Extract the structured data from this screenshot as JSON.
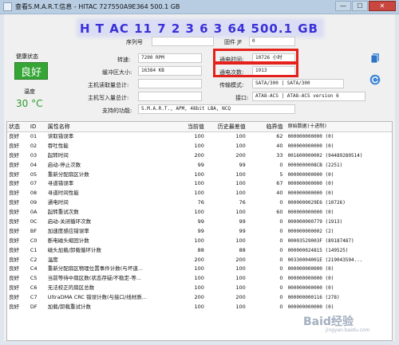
{
  "window": {
    "title": "查看S.M.A.R.T.信息 - HITAC    727550A9E364 500.1 GB",
    "min": "—",
    "max": "☐",
    "close": "✕"
  },
  "header": {
    "model": "H T AC   11 7 2   3   6 3 64 500.1 GB"
  },
  "info": {
    "serial_label": "序列号",
    "serial_value": "",
    "firmware_label": "固件 JF",
    "firmware_value": "0",
    "rpm_label": "转速:",
    "rpm_value": "7200 RPM",
    "buffer_label": "缓冲区大小:",
    "buffer_value": "16384 KB",
    "host_read_label": "主机读取量总计:",
    "host_read_value": "",
    "host_write_label": "主机写入量总计:",
    "host_write_value": "",
    "features_label": "支持的功能:",
    "features_value": "S.M.A.R.T., APM, 48bit LBA, NCQ",
    "power_on_hours_label": "通电时间:",
    "power_on_hours_value": "10726 小时",
    "power_on_count_label": "通电次数:",
    "power_on_count_value": "1913",
    "transfer_label": "传输模式:",
    "transfer_value": "SATA/300 | SATA/300",
    "interface_label": "接口:",
    "interface_value": "ATA8-ACS | ATA8-ACS version 6"
  },
  "status": {
    "health_label": "健康状态",
    "health_value": "良好",
    "temp_label": "温度",
    "temp_value": "30 °C"
  },
  "table": {
    "headers": [
      "状态",
      "ID",
      "属性名称",
      "当前值",
      "历史最差值",
      "临界值",
      "原始数据(十进制)"
    ],
    "rows": [
      [
        "良好",
        "01",
        "读取错误率",
        "100",
        "100",
        "62",
        "000000000000 (0)"
      ],
      [
        "良好",
        "02",
        "吞吐性能",
        "100",
        "100",
        "40",
        "000000000000 (0)"
      ],
      [
        "良好",
        "03",
        "起转时间",
        "200",
        "200",
        "33",
        "001600000002 (94489280514)"
      ],
      [
        "良好",
        "04",
        "启动-停止次数",
        "99",
        "99",
        "0",
        "0000000008CB (2251)"
      ],
      [
        "良好",
        "05",
        "重新分配扇区计数",
        "100",
        "100",
        "5",
        "000000000000 (0)"
      ],
      [
        "良好",
        "07",
        "寻道错误率",
        "100",
        "100",
        "67",
        "000000000000 (0)"
      ],
      [
        "良好",
        "08",
        "寻道时间性能",
        "100",
        "100",
        "40",
        "000000000000 (0)"
      ],
      [
        "良好",
        "09",
        "通电时间",
        "76",
        "76",
        "0",
        "0000000029E6 (10726)"
      ],
      [
        "良好",
        "0A",
        "起转重试次数",
        "100",
        "100",
        "60",
        "000000000000 (0)"
      ],
      [
        "良好",
        "0C",
        "启动-关闭循环次数",
        "99",
        "99",
        "0",
        "000000000779 (1913)"
      ],
      [
        "良好",
        "BF",
        "加速度感应错误率",
        "99",
        "99",
        "0",
        "000000000002 (2)"
      ],
      [
        "良好",
        "C0",
        "断电磁头缩回计数",
        "100",
        "100",
        "0",
        "00003529003F (89187487)"
      ],
      [
        "良好",
        "C1",
        "磁头加载/卸载循环计数",
        "88",
        "88",
        "0",
        "000000024815 (149525)"
      ],
      [
        "良好",
        "C2",
        "温度",
        "200",
        "200",
        "0",
        "00330004001E (219043594..."
      ],
      [
        "良好",
        "C4",
        "重新分配扇区物理位置事件计数(与坏道...",
        "100",
        "100",
        "0",
        "000000000000 (0)"
      ],
      [
        "良好",
        "C5",
        "当前等待中扇区数(状态存疑/不稳定-等...",
        "100",
        "100",
        "0",
        "000000000000 (0)"
      ],
      [
        "良好",
        "C6",
        "无法校正的扇区总数",
        "100",
        "100",
        "0",
        "000000000000 (0)"
      ],
      [
        "良好",
        "C7",
        "UltraDMA CRC 错误计数(与接口/线材质...",
        "200",
        "200",
        "0",
        "000000000116 (278)"
      ],
      [
        "良好",
        "DF",
        "加载/卸载重试计数",
        "100",
        "100",
        "0",
        "000000000000 (0)"
      ]
    ]
  },
  "watermark": {
    "text": "Baid经验",
    "sub": "jingyan.baidu.com"
  },
  "colors": {
    "health_green": "#35a535",
    "highlight_red": "#e4221b",
    "model_blue": "#3a30d8"
  }
}
